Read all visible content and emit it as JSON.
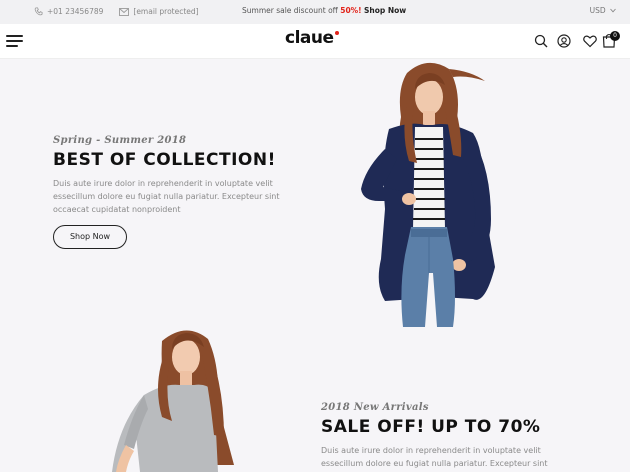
{
  "topbar": {
    "phone": "+01 23456789",
    "email": "[email protected]",
    "promo_text": "Summer sale discount off ",
    "promo_percent": "50%!",
    "promo_link": "Shop Now",
    "currency": "USD"
  },
  "header": {
    "logo": "claue",
    "cart_count": "0"
  },
  "hero1": {
    "subtitle": "Spring - Summer 2018",
    "headline": "BEST OF COLLECTION!",
    "paragraph": "Duis aute irure dolor in reprehenderit in voluptate velit essecillum dolore eu fugiat nulla pariatur. Excepteur sint occaecat cupidatat nonproident",
    "button": "Shop Now"
  },
  "hero2": {
    "subtitle": "2018 New Arrivals",
    "headline": "SALE OFF! UP TO 70%",
    "paragraph": "Duis aute irure dolor in reprehenderit in voluptate velit essecillum dolore eu fugiat nulla pariatur. Excepteur sint"
  },
  "colors": {
    "accent": "#e2231a",
    "cardigan": "#1f2a55",
    "jeans": "#5b7fa8",
    "hair": "#8a4b2b"
  }
}
